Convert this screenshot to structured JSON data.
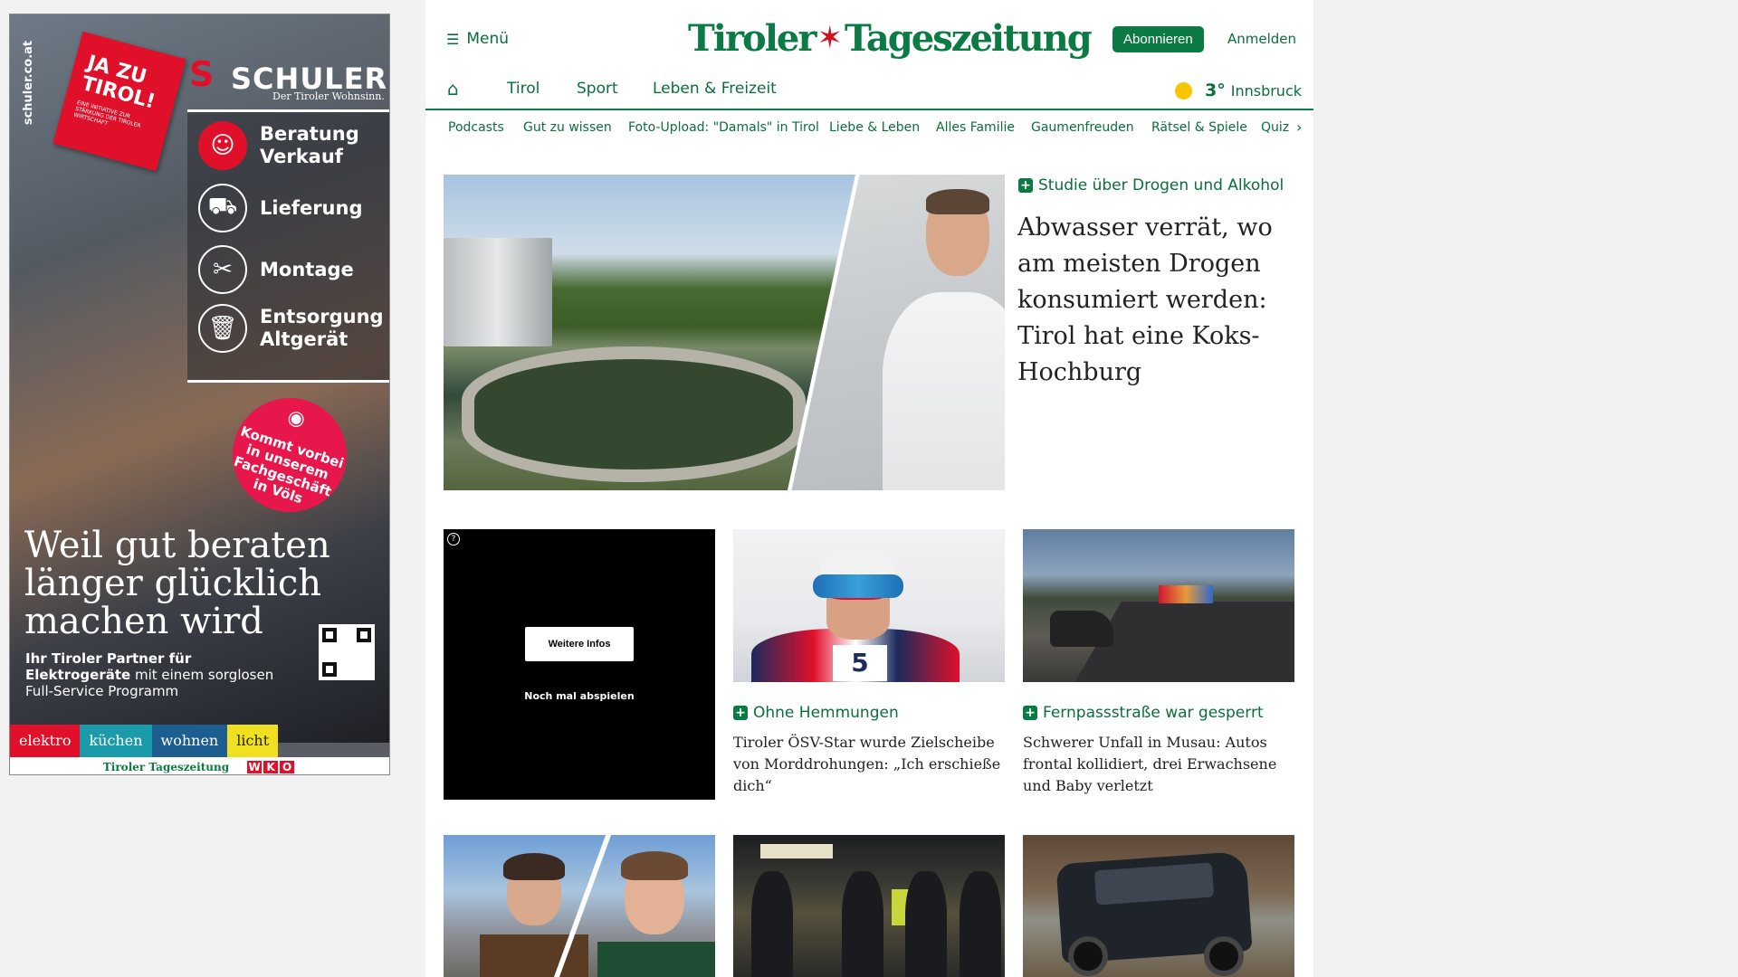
{
  "ad": {
    "vertical_url": "schuler.co.at",
    "red_box_title": "JA ZU TIROL!",
    "red_box_small": "EINE INITIATIVE ZUR STÄRKUNG DER TIROLER WIRTSCHAFT",
    "brand": "SCHULER",
    "brand_claim": "Der Tiroler Wohnsinn.",
    "services": [
      "Beratung\nVerkauf",
      "Lieferung",
      "Montage",
      "Entsorgung\nAltgerät"
    ],
    "badge": "Kommt vorbei in unserem Fachgeschäft in Völs",
    "headline": "Weil gut beraten länger glücklich machen wird",
    "subline_bold": "Ihr Tiroler Partner für Elektrogeräte",
    "subline_rest": " mit einem sorglosen Full-Service Programm",
    "categories": [
      {
        "label": "elektro",
        "color": "#e0102a"
      },
      {
        "label": "küchen",
        "color": "#1b9aaa"
      },
      {
        "label": "wohnen",
        "color": "#1c5e8f"
      },
      {
        "label": "licht",
        "color": "#f0e020"
      }
    ],
    "footer_tt": "Tiroler Tageszeitung",
    "footer_wko": [
      "W",
      "K",
      "O"
    ]
  },
  "header": {
    "menu_label": "Menü",
    "logo_word1": "Tiroler",
    "logo_word2": "Tageszeitung",
    "subscribe_label": "Abonnieren",
    "login_label": "Anmelden"
  },
  "nav": {
    "items": [
      "Tirol",
      "Sport",
      "Leben & Freizeit"
    ],
    "weather_temp": "3°",
    "weather_city": "Innsbruck"
  },
  "subnav": {
    "items": [
      "Podcasts",
      "Gut zu wissen",
      "Foto-Upload: \"Damals\" in Tirol",
      "Liebe & Leben",
      "Alles Familie",
      "Gaumenfreuden",
      "Rätsel & Spiele",
      "Quiz"
    ]
  },
  "lead": {
    "tag": "Studie über Drogen und Alkohol",
    "title": "Abwasser verrät, wo am meisten Drogen konsumiert werden: Tirol hat eine Koks-Hochburg"
  },
  "video": {
    "more_label": "Weitere Infos",
    "replay_label": "Noch mal abspielen",
    "help_icon": "?"
  },
  "cards": [
    {
      "tag": "Ohne Hemmungen",
      "title": "Tiroler ÖSV-Star wurde Zielscheibe von Morddrohungen: „Ich erschieße dich“",
      "bib": "5"
    },
    {
      "tag": "Fernpassstraße war gesperrt",
      "title": "Schwerer Unfall in Musau: Autos frontal kollidiert, drei Erwachsene und Baby verletzt"
    }
  ],
  "colors": {
    "brand_green": "#0b7a43",
    "eagle_red": "#d4101c",
    "sun_yellow": "#f7c600"
  }
}
